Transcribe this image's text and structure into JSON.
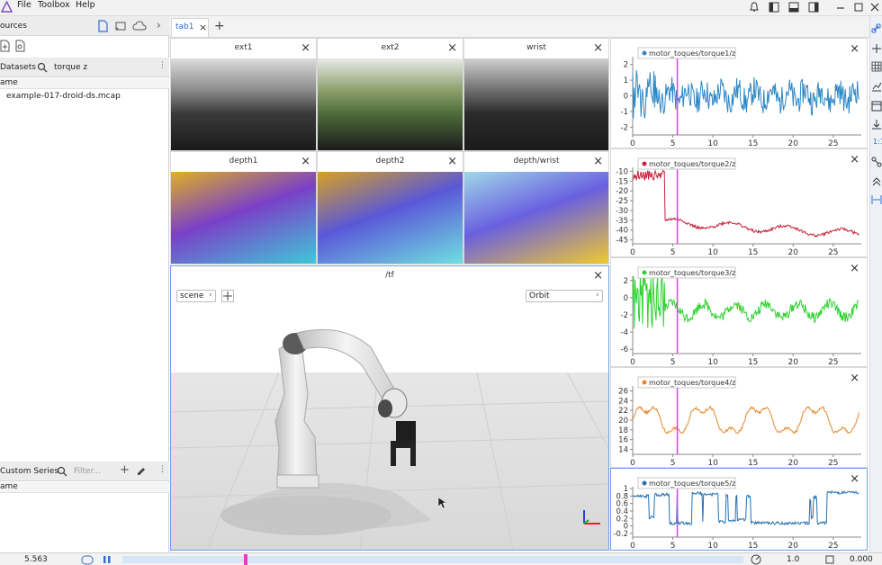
{
  "menubar": {
    "items": [
      "File",
      "Toolbox",
      "Help"
    ]
  },
  "sources": {
    "title": "ources"
  },
  "datasets": {
    "label": "Datasets",
    "query": "torque z",
    "col": "ame",
    "files": [
      "example-017-droid-ds.mcap"
    ]
  },
  "custom": {
    "title": "Custom Series",
    "placeholder": "Filter...",
    "col": "ame"
  },
  "tabs": {
    "active": "tab1",
    "add": "+"
  },
  "cameras": {
    "row1": [
      {
        "title": "ext1"
      },
      {
        "title": "ext2"
      },
      {
        "title": "wrist"
      }
    ],
    "row2": [
      {
        "title": "depth1"
      },
      {
        "title": "depth2"
      },
      {
        "title": "depth/wrist"
      }
    ]
  },
  "tf": {
    "title": "/tf",
    "scene": "scene",
    "orbit": "Orbit"
  },
  "plots": [
    {
      "menu": "...",
      "legend": "motor_toques/torque1/z",
      "color": "#2e87c4",
      "yticks": [
        "2",
        "1",
        "0",
        "-1",
        "-2"
      ],
      "ymin": -2.5,
      "ymax": 2.5,
      "seed": 11,
      "base": "noise"
    },
    {
      "menu": "...",
      "legend": "motor_toques/torque2/z",
      "color": "#c9213a",
      "yticks": [
        "-10",
        "-15",
        "-20",
        "-25",
        "-30",
        "-35",
        "-40",
        "-45"
      ],
      "ymin": -47,
      "ymax": -8,
      "seed": 22,
      "base": "decay"
    },
    {
      "menu": "...",
      "legend": "motor_toques/torque3/z",
      "color": "#2fd12f",
      "yticks": [
        "2",
        "0",
        "-2",
        "-4",
        "-6"
      ],
      "ymin": -6.5,
      "ymax": 2.5,
      "seed": 33,
      "base": "noise3"
    },
    {
      "menu": "...",
      "legend": "motor_toques/torque4/z",
      "color": "#e8862b",
      "yticks": [
        "26",
        "24",
        "22",
        "20",
        "18",
        "16",
        "14"
      ],
      "ymin": 13,
      "ymax": 27,
      "seed": 44,
      "base": "wave"
    },
    {
      "menu": "...",
      "legend": "motor_toques/torque5/z",
      "color": "#2570b0",
      "yticks": [
        "1",
        "0.8",
        "0.6",
        "0.4",
        "0.2",
        "0",
        "-0.2"
      ],
      "ymin": -0.3,
      "ymax": 1.05,
      "seed": 55,
      "base": "square"
    }
  ],
  "xticks": [
    "0",
    "5",
    "10",
    "15",
    "20",
    "25"
  ],
  "bottom": {
    "time": "5.563",
    "speed": "1.0",
    "offset": "0.000"
  }
}
